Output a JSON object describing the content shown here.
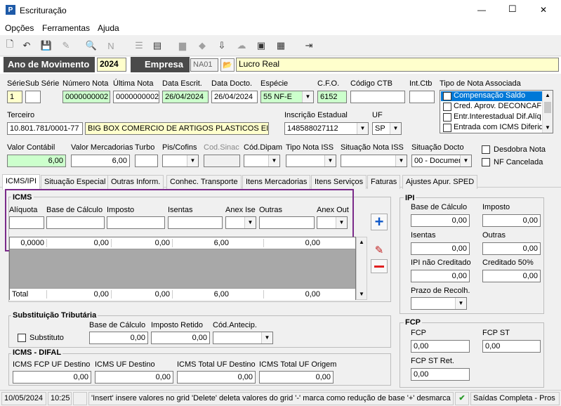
{
  "window": {
    "title": "Escrituração",
    "minimize": "—",
    "maximize": "☐",
    "close": "✕"
  },
  "menu": [
    "Opções",
    "Ferramentas",
    "Ajuda"
  ],
  "year_bar": {
    "ano_label": "Ano de Movimento",
    "ano_value": "2024",
    "empresa_label": "Empresa",
    "empresa_code": "NA01",
    "empresa_name": "Lucro Real"
  },
  "header": {
    "serie_label": "Série",
    "serie_value": "1",
    "subserie_label": "Sub Série",
    "subserie_value": "",
    "numero_nota_label": "Número Nota",
    "numero_nota_value": "0000000002",
    "ultima_nota_label": "Última Nota",
    "ultima_nota_value": "0000000002",
    "data_escrit_label": "Data Escrit.",
    "data_escrit_value": "26/04/2024",
    "data_docto_label": "Data Docto.",
    "data_docto_value": "26/04/2024",
    "especie_label": "Espécie",
    "especie_value": "55   NF-E",
    "cfo_label": "C.F.O.",
    "cfo_value": "6152",
    "codigo_ctb_label": "Código CTB",
    "codigo_ctb_value": "",
    "int_ctb_label": "Int.Ctb",
    "int_ctb_value": "",
    "tipo_nota_label": "Tipo de Nota Associada",
    "tipo_nota_items": [
      "Compensação Saldo",
      "Cred. Aprov. DECONCAFÉ",
      "Entr.Interestadual Dif.Alíq",
      "Entrada com ICMS Diferido"
    ],
    "terceiro_label": "Terceiro",
    "terceiro_cnpj": "10.801.781/0001-77",
    "terceiro_nome": "BIG BOX COMERCIO DE ARTIGOS PLASTICOS EIRELI",
    "inscricao_label": "Inscrição Estadual",
    "inscricao_value": "148588027112",
    "uf_label": "UF",
    "uf_value": "SP",
    "valor_contabil_label": "Valor Contábil",
    "valor_contabil_value": "6,00",
    "valor_mercadorias_label": "Valor Mercadorias",
    "valor_mercadorias_value": "6,00",
    "turbo_label": "Turbo",
    "turbo_value": "",
    "pis_label": "Pis/Cofins",
    "pis_value": "",
    "cod_sinac_label": "Cod.Sinac",
    "cod_sinac_value": "",
    "cod_dipam_label": "Cód.Dipam",
    "cod_dipam_value": "",
    "tipo_iss_label": "Tipo Nota ISS",
    "tipo_iss_value": "",
    "sit_iss_label": "Situação Nota ISS",
    "sit_iss_value": "",
    "sit_docto_label": "Situação Docto",
    "sit_docto_value": "00 - Documen",
    "desdobra_label": "Desdobra Nota",
    "cancelada_label": "NF Cancelada"
  },
  "tabs": [
    "ICMS/IPI",
    "Situação Especial",
    "Outras Inform.",
    "Conhec. Transporte",
    "Itens Mercadorias",
    "Itens Serviços",
    "Faturas",
    "Ajustes Apur. SPED"
  ],
  "icms": {
    "title": "ICMS",
    "cols": [
      "Alíquota",
      "Base de Cálculo",
      "Imposto",
      "Isentas",
      "Anex Ise",
      "Outras",
      "Anex Out"
    ],
    "row": [
      "0,0000",
      "0,00",
      "0,00",
      "6,00",
      "",
      "0,00",
      ""
    ],
    "total_label": "Total",
    "totals": [
      "0,00",
      "0,00",
      "6,00",
      "0,00"
    ]
  },
  "st": {
    "title": "Substituição Tributária",
    "substituto_label": "Substituto",
    "base_label": "Base de Cálculo",
    "base_value": "0,00",
    "imposto_label": "Imposto Retido",
    "imposto_value": "0,00",
    "cod_label": "Cód.Antecip.",
    "cod_value": ""
  },
  "difal": {
    "title": "ICMS - DIFAL",
    "fcp_label": "ICMS FCP UF Destino",
    "fcp_value": "0,00",
    "dest_label": "ICMS UF Destino",
    "dest_value": "0,00",
    "total_dest_label": "ICMS Total UF Destino",
    "total_dest_value": "0,00",
    "total_orig_label": "ICMS Total UF Origem",
    "total_orig_value": "0,00"
  },
  "ipi": {
    "title": "IPI",
    "base_label": "Base de Cálculo",
    "base_value": "0,00",
    "imposto_label": "Imposto",
    "imposto_value": "0,00",
    "isentas_label": "Isentas",
    "isentas_value": "0,00",
    "outras_label": "Outras",
    "outras_value": "0,00",
    "ipi_nc_label": "IPI não Creditado",
    "ipi_nc_value": "0,00",
    "cred50_label": "Creditado 50%",
    "cred50_value": "0,00",
    "prazo_label": "Prazo de Recolh.",
    "prazo_value": ""
  },
  "fcp": {
    "title": "FCP",
    "fcp_label": "FCP",
    "fcp_value": "0,00",
    "fcp_st_label": "FCP ST",
    "fcp_st_value": "0,00",
    "fcp_st_ret_label": "FCP ST Ret.",
    "fcp_st_ret_value": "0,00"
  },
  "status": {
    "date": "10/05/2024",
    "time": "10:25",
    "message": "'Insert' insere valores no grid 'Delete' deleta valores do grid '-' marca como redução de base '+' desmarca re",
    "mode": "Saídas Completa - Pros"
  },
  "colors": {
    "highlight": "#7b2a8a",
    "green": "#ccffcc",
    "yellow": "#ffffcc",
    "selection": "#0078d7"
  }
}
